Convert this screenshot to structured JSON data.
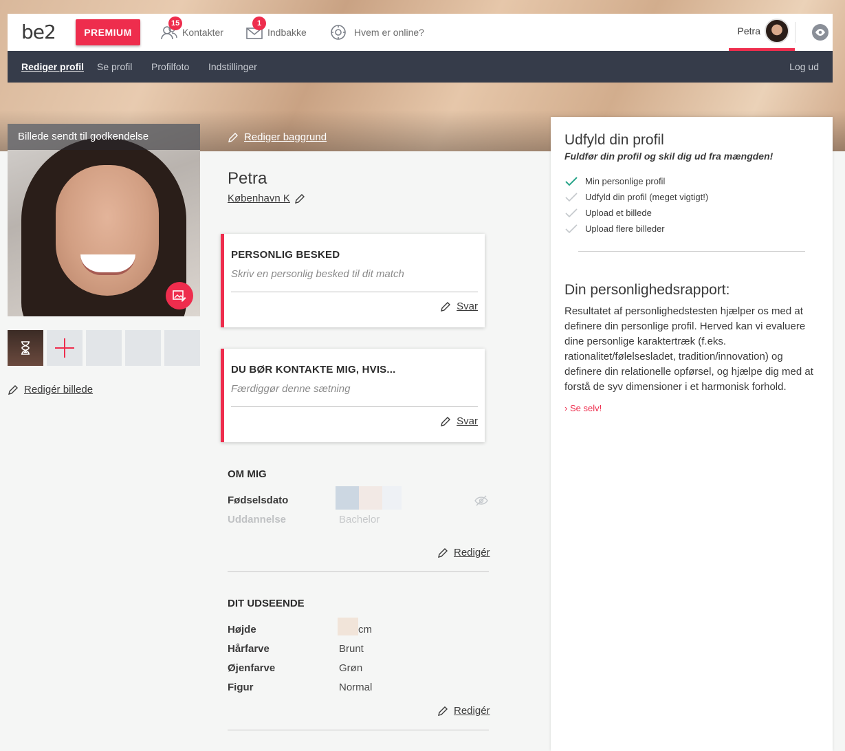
{
  "brand": {
    "logo": "be2",
    "accent": "#ee2d4d",
    "dark": "#363c4a"
  },
  "topnav": {
    "premium_label": "PREMIUM",
    "items": [
      {
        "label": "Kontakter",
        "badge": "15",
        "icon": "contacts-icon"
      },
      {
        "label": "Indbakke",
        "badge": "1",
        "icon": "mail-icon"
      },
      {
        "label": "Hvem er online?",
        "badge": "",
        "icon": "online-icon"
      }
    ],
    "user_name": "Petra"
  },
  "subnav": {
    "items": [
      "Rediger profil",
      "Se profil",
      "Profilfoto",
      "Indstillinger"
    ],
    "logout": "Log ud"
  },
  "photo": {
    "caption": "Billede sendt til godkendelse",
    "edit_label": "Redigér billede"
  },
  "background_edit": "Rediger baggrund",
  "profile": {
    "name": "Petra",
    "city": "København K"
  },
  "cards": [
    {
      "title": "PERSONLIG BESKED",
      "placeholder": "Skriv en personlig besked til dit match",
      "reply": "Svar"
    },
    {
      "title": "DU BØR KONTAKTE MIG, HVIS...",
      "placeholder": "Færdiggør denne sætning",
      "reply": "Svar"
    }
  ],
  "about": {
    "title": "OM MIG",
    "fields": [
      {
        "label": "Fødselsdato",
        "value": ""
      },
      {
        "label": "Uddannelse",
        "value": "Bachelor"
      }
    ],
    "edit": "Redigér"
  },
  "appearance": {
    "title": "DIT UDSEENDE",
    "fields": [
      {
        "label": "Højde",
        "value": "cm"
      },
      {
        "label": "Hårfarve",
        "value": "Brunt"
      },
      {
        "label": "Øjenfarve",
        "value": "Grøn"
      },
      {
        "label": "Figur",
        "value": "Normal"
      }
    ],
    "edit": "Redigér"
  },
  "sidebar": {
    "title": "Udfyld din profil",
    "subtitle": "Fuldfør din profil og skil dig ud fra mængden!",
    "checklist": [
      {
        "label": "Min personlige profil",
        "done": true
      },
      {
        "label": "Udfyld din profil (meget vigtigt!)",
        "done": false
      },
      {
        "label": "Upload et billede",
        "done": false
      },
      {
        "label": "Upload flere billeder",
        "done": false
      }
    ],
    "report_title": "Din personlighedsrapport:",
    "report_text": "Resultatet af personlighedstesten hjælper os med at definere din personlige profil. Herved kan vi evaluere dine personlige karaktertræk (f.eks. rationalitet/følelsesladet, tradition/innovation) og definere din relationelle opførsel, og hjælpe dig med at forstå de syv dimensioner i et harmonisk forhold.",
    "see_link": "Se selv!"
  }
}
